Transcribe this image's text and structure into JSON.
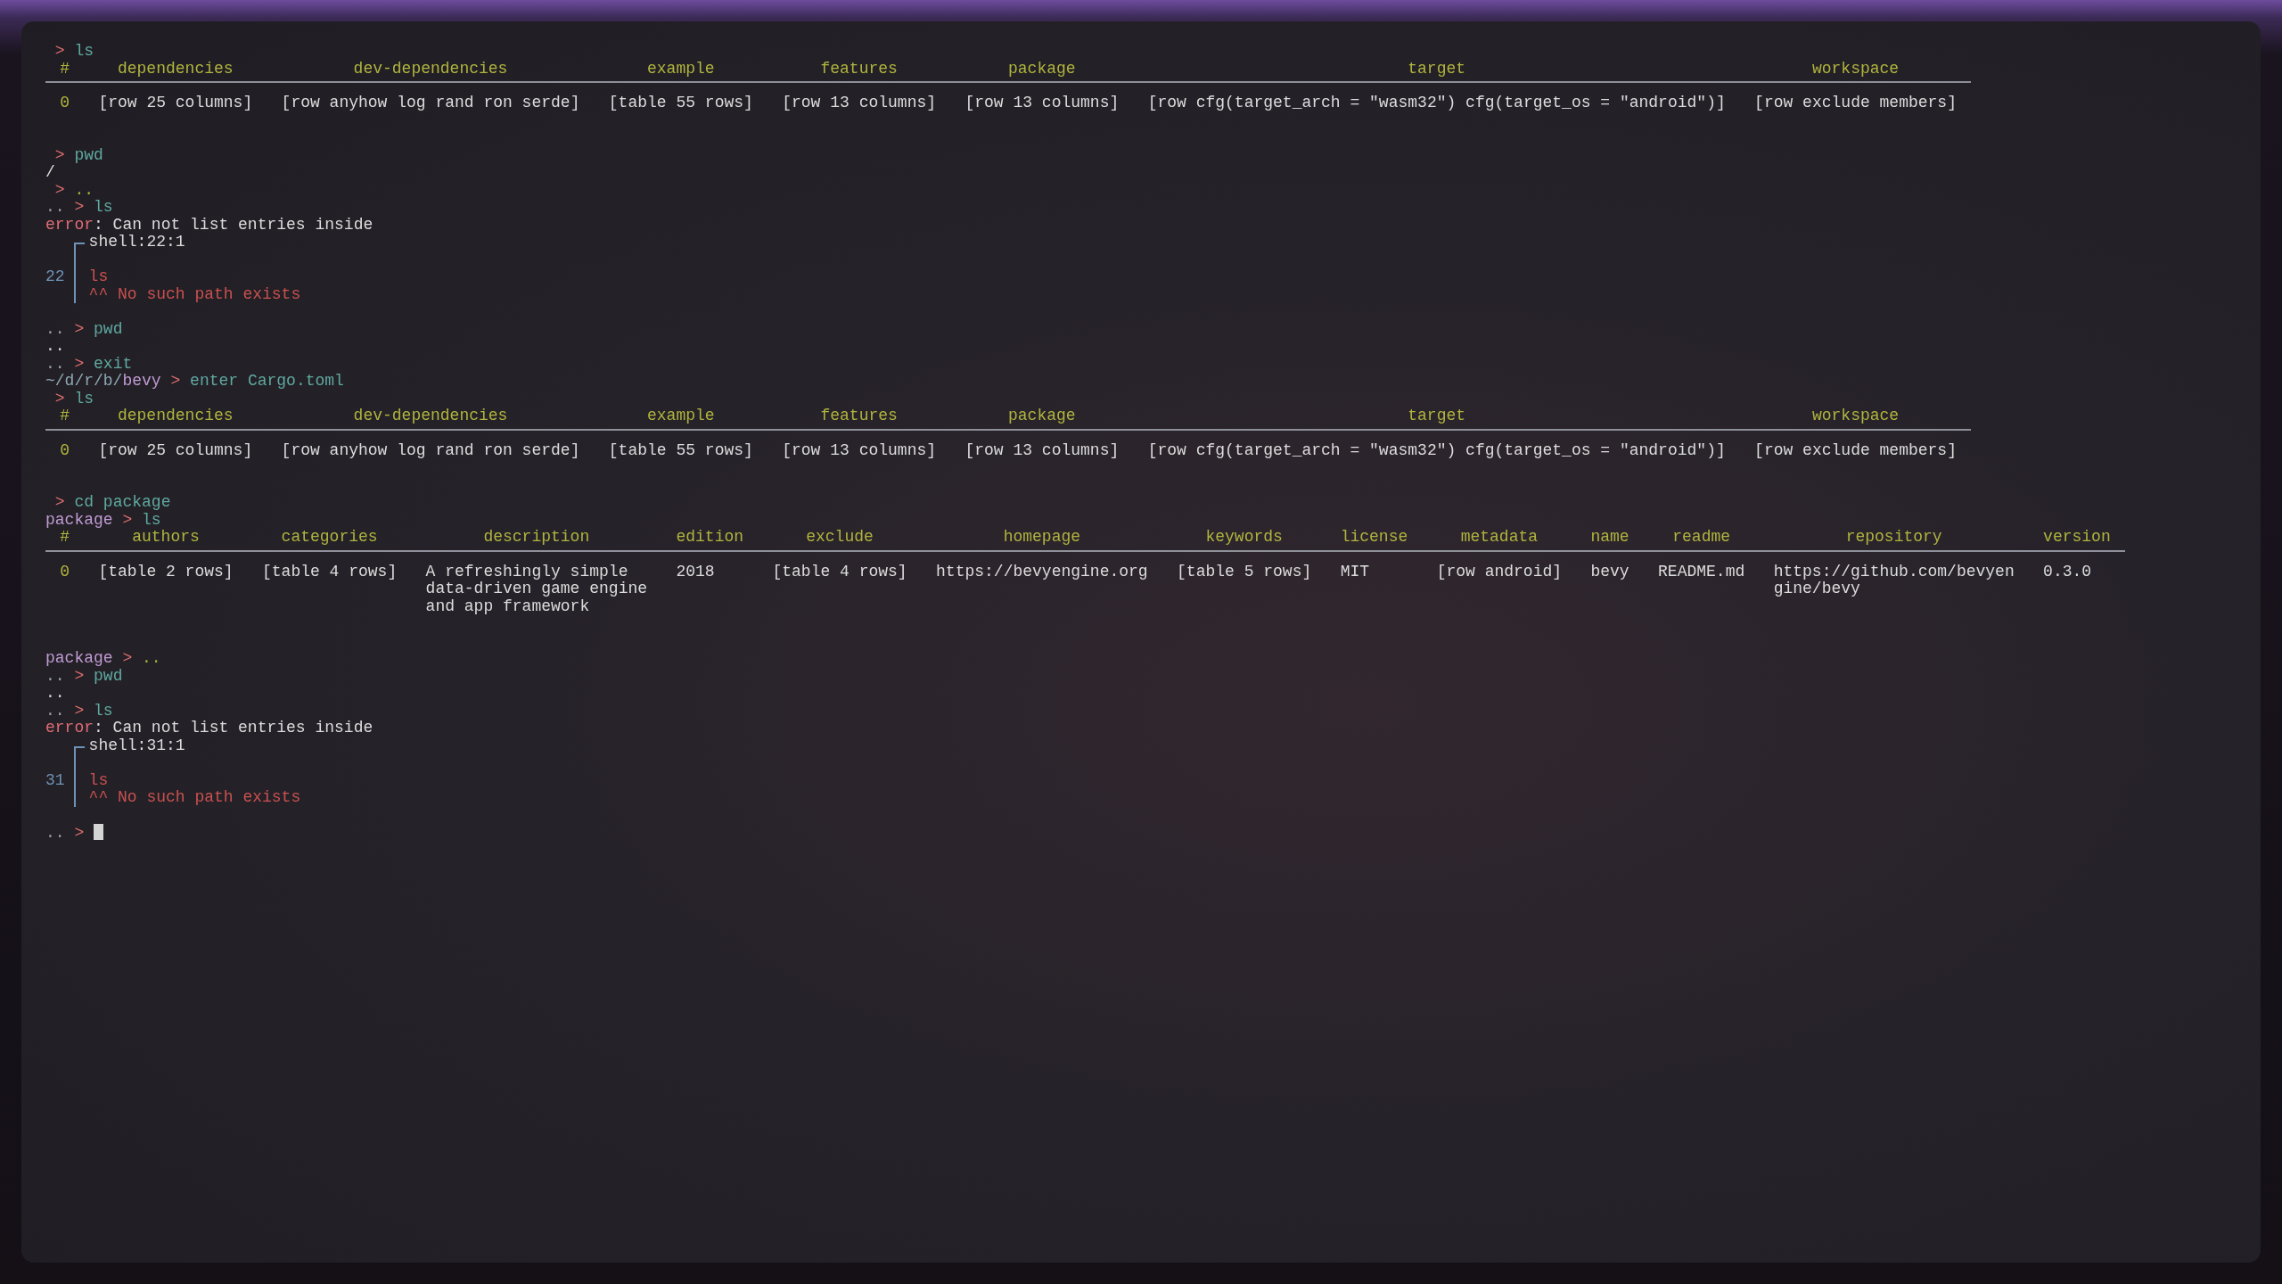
{
  "terminal": {
    "lines": [
      {
        "kind": "prompt",
        "symbol": ">",
        "command": "ls",
        "valid": true
      },
      {
        "kind": "table",
        "columns": [
          "#",
          "dependencies",
          "dev-dependencies",
          "example",
          "features",
          "package",
          "target",
          "workspace"
        ],
        "rows": [
          [
            "0",
            "[row 25 columns]",
            "[row anyhow log rand ron serde]",
            "[table 55 rows]",
            "[row 13 columns]",
            "[row 13 columns]",
            "[row cfg(target_arch = \"wasm32\") cfg(target_os = \"android\")]",
            "[row exclude members]"
          ]
        ]
      },
      {
        "kind": "blank"
      },
      {
        "kind": "blank"
      },
      {
        "kind": "prompt",
        "symbol": ">",
        "command": "pwd",
        "valid": true
      },
      {
        "kind": "output",
        "text": "/"
      },
      {
        "kind": "prompt",
        "symbol": ">",
        "command": "..",
        "valid": false
      },
      {
        "kind": "prompt",
        "path": "..",
        "symbol": ">",
        "command": "ls",
        "valid": true
      },
      {
        "kind": "error",
        "label": "error",
        "message": ": Can not list entries inside",
        "location": "shell:22:1",
        "line_number": "22",
        "source": "ls",
        "note": "^^ No such path exists"
      },
      {
        "kind": "blank"
      },
      {
        "kind": "prompt",
        "path": "..",
        "symbol": ">",
        "command": "pwd",
        "valid": true
      },
      {
        "kind": "output",
        "text": ".."
      },
      {
        "kind": "prompt",
        "path": "..",
        "symbol": ">",
        "command": "exit",
        "valid": true
      },
      {
        "kind": "prompt",
        "path": "~/d/r/b/",
        "dir": "bevy",
        "symbol": ">",
        "command": "enter Cargo.toml",
        "valid": true
      },
      {
        "kind": "prompt",
        "symbol": ">",
        "command": "ls",
        "valid": true
      },
      {
        "kind": "table",
        "columns": [
          "#",
          "dependencies",
          "dev-dependencies",
          "example",
          "features",
          "package",
          "target",
          "workspace"
        ],
        "rows": [
          [
            "0",
            "[row 25 columns]",
            "[row anyhow log rand ron serde]",
            "[table 55 rows]",
            "[row 13 columns]",
            "[row 13 columns]",
            "[row cfg(target_arch = \"wasm32\") cfg(target_os = \"android\")]",
            "[row exclude members]"
          ]
        ]
      },
      {
        "kind": "blank"
      },
      {
        "kind": "blank"
      },
      {
        "kind": "prompt",
        "symbol": ">",
        "command": "cd package",
        "valid": true
      },
      {
        "kind": "prompt",
        "dir": "package",
        "symbol": ">",
        "command": "ls",
        "valid": true
      },
      {
        "kind": "table",
        "columns": [
          "#",
          "authors",
          "categories",
          "description",
          "edition",
          "exclude",
          "homepage",
          "keywords",
          "license",
          "metadata",
          "name",
          "readme",
          "repository",
          "version"
        ],
        "rows": [
          [
            "0",
            "[table 2 rows]",
            "[table 4 rows]",
            "A refreshingly simple\ndata-driven game engine\nand app framework",
            "2018",
            "[table 4 rows]",
            "https://bevyengine.org",
            "[table 5 rows]",
            "MIT",
            "[row android]",
            "bevy",
            "README.md",
            "https://github.com/bevyen\ngine/bevy",
            "0.3.0"
          ]
        ]
      },
      {
        "kind": "blank"
      },
      {
        "kind": "blank"
      },
      {
        "kind": "prompt",
        "dir": "package",
        "symbol": ">",
        "command": "..",
        "valid": false
      },
      {
        "kind": "prompt",
        "path": "..",
        "symbol": ">",
        "command": "pwd",
        "valid": true
      },
      {
        "kind": "output",
        "text": ".."
      },
      {
        "kind": "prompt",
        "path": "..",
        "symbol": ">",
        "command": "ls",
        "valid": true
      },
      {
        "kind": "error",
        "label": "error",
        "message": ": Can not list entries inside",
        "location": "shell:31:1",
        "line_number": "31",
        "source": "ls",
        "note": "^^ No such path exists"
      },
      {
        "kind": "blank"
      },
      {
        "kind": "prompt",
        "path": "..",
        "symbol": ">",
        "cursor": true
      }
    ]
  }
}
